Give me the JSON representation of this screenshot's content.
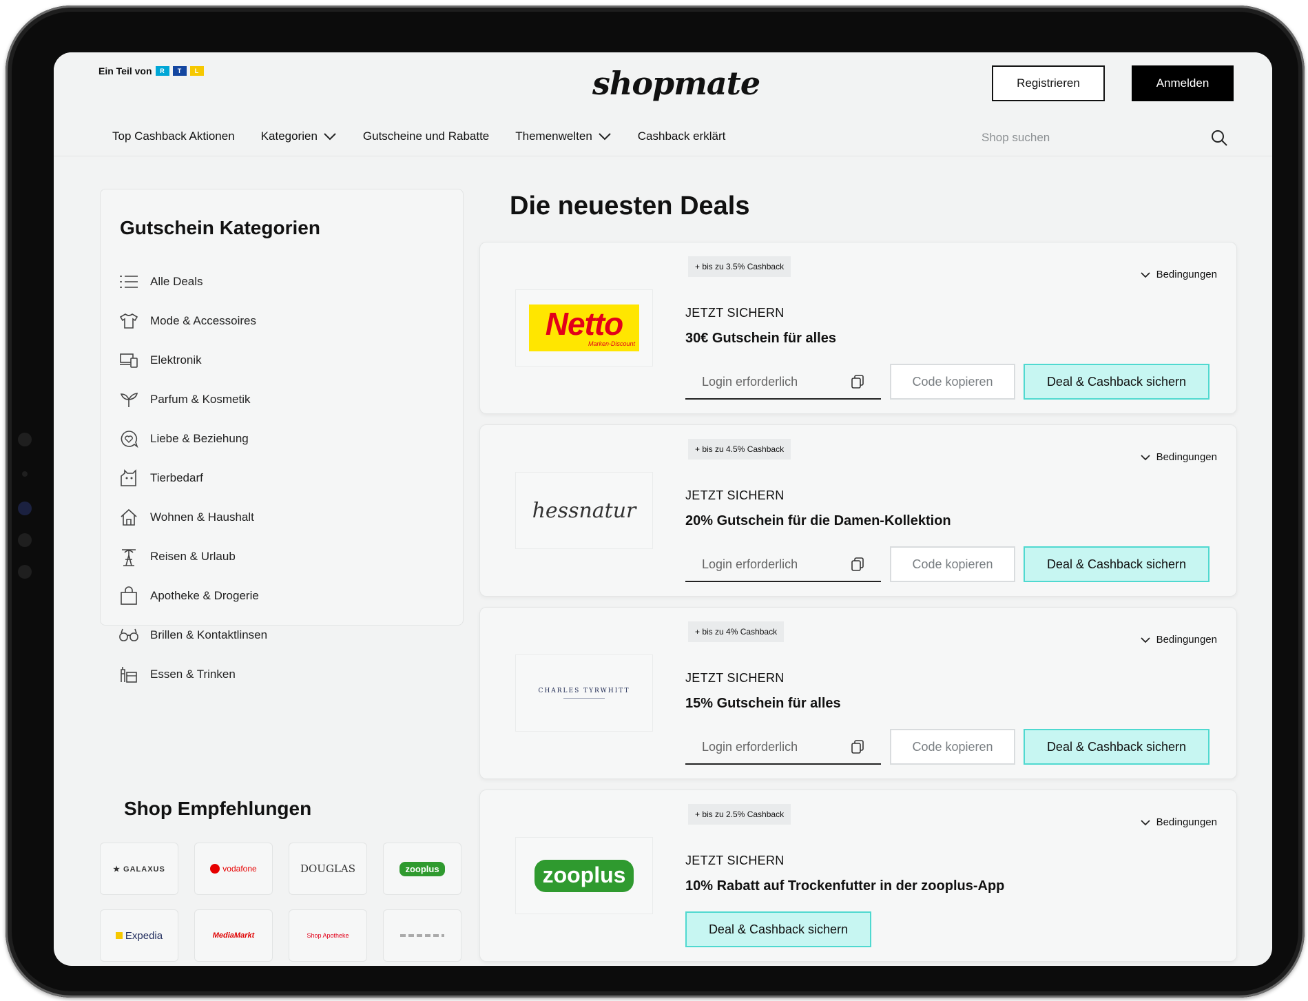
{
  "header": {
    "ein_teil_von": "Ein Teil von",
    "rtl_letters": [
      "R",
      "T",
      "L"
    ],
    "logo": "shopmate",
    "register_label": "Registrieren",
    "login_label": "Anmelden"
  },
  "nav": {
    "items": [
      {
        "label": "Top Cashback Aktionen",
        "has_dropdown": false
      },
      {
        "label": "Kategorien",
        "has_dropdown": true
      },
      {
        "label": "Gutscheine und Rabatte",
        "has_dropdown": false
      },
      {
        "label": "Themenwelten",
        "has_dropdown": true
      },
      {
        "label": "Cashback erklärt",
        "has_dropdown": false
      }
    ],
    "search_placeholder": "Shop suchen"
  },
  "sidebar": {
    "title": "Gutschein Kategorien",
    "categories": [
      {
        "label": "Alle Deals",
        "icon": "list-icon"
      },
      {
        "label": "Mode & Accessoires",
        "icon": "shirt-icon"
      },
      {
        "label": "Elektronik",
        "icon": "devices-icon"
      },
      {
        "label": "Parfum & Kosmetik",
        "icon": "sprout-icon"
      },
      {
        "label": "Liebe & Beziehung",
        "icon": "heart-chat-icon"
      },
      {
        "label": "Tierbedarf",
        "icon": "pet-icon"
      },
      {
        "label": "Wohnen & Haushalt",
        "icon": "home-icon"
      },
      {
        "label": "Reisen & Urlaub",
        "icon": "palm-icon"
      },
      {
        "label": "Apotheke & Drogerie",
        "icon": "bag-icon"
      },
      {
        "label": "Brillen & Kontaktlinsen",
        "icon": "glasses-icon"
      },
      {
        "label": "Essen & Trinken",
        "icon": "food-icon"
      }
    ],
    "shop_title": "Shop Empfehlungen",
    "shops": [
      {
        "label": "★ GALAXUS",
        "color": "#333333"
      },
      {
        "label": "vodafone",
        "color": "#e60000"
      },
      {
        "label": "DOUGLAS",
        "color": "#333333"
      },
      {
        "label": "zooplus",
        "color": "#ffffff"
      },
      {
        "label": "Expedia",
        "color": "#1f2b5c"
      },
      {
        "label": "MediaMarkt",
        "color": "#df0000"
      },
      {
        "label": "Shop Apotheke",
        "color": "#e2001a"
      },
      {
        "label": "",
        "color": "#999999"
      }
    ]
  },
  "deals": {
    "title": "Die neuesten Deals",
    "items": [
      {
        "cashback": "+ bis zu 3.5% Cashback",
        "shop": "Netto",
        "shop_sub": "Marken-Discount",
        "jetzt": "JETZT SICHERN",
        "text": "30€ Gutschein für alles",
        "has_code": true
      },
      {
        "cashback": "+ bis zu 4.5% Cashback",
        "shop": "hessnatur",
        "jetzt": "JETZT SICHERN",
        "text": "20% Gutschein für die Damen-Kollektion",
        "has_code": true
      },
      {
        "cashback": "+ bis zu 4% Cashback",
        "shop": "CHARLES TYRWHITT",
        "jetzt": "JETZT SICHERN",
        "text": "15% Gutschein für alles",
        "has_code": true
      },
      {
        "cashback": "+ bis zu 2.5% Cashback",
        "shop": "zooplus",
        "jetzt": "JETZT SICHERN",
        "text": "10% Rabatt auf Trockenfutter in der zooplus-App",
        "has_code": false
      }
    ],
    "conditions_label": "Bedingungen",
    "login_required": "Login erforderlich",
    "copy_code_label": "Code kopieren",
    "deal_button_label": "Deal & Cashback sichern"
  },
  "colors": {
    "accent_cyan": "#c7f6f2",
    "accent_cyan_border": "#4fd9d0",
    "netto_red": "#e2001a",
    "netto_yellow": "#ffe600",
    "zooplus_green": "#2f9a2f",
    "rtl_red": "#00a6d6",
    "rtl_blue": "#1446a0",
    "rtl_yellow": "#f6c800"
  }
}
